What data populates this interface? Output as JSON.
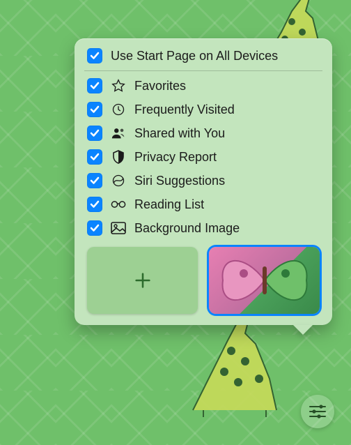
{
  "popover": {
    "master": {
      "label": "Use Start Page on All Devices",
      "checked": true
    },
    "items": [
      {
        "label": "Favorites",
        "icon": "star-icon",
        "checked": true
      },
      {
        "label": "Frequently Visited",
        "icon": "clock-icon",
        "checked": true
      },
      {
        "label": "Shared with You",
        "icon": "people-icon",
        "checked": true
      },
      {
        "label": "Privacy Report",
        "icon": "shield-icon",
        "checked": true
      },
      {
        "label": "Siri Suggestions",
        "icon": "siri-icon",
        "checked": true
      },
      {
        "label": "Reading List",
        "icon": "glasses-icon",
        "checked": true
      },
      {
        "label": "Background Image",
        "icon": "photo-icon",
        "checked": true
      }
    ],
    "thumbnails": {
      "add": "add-background-image",
      "selected": "butterfly-wallpaper"
    }
  },
  "controls": {
    "settings": "start-page-settings"
  },
  "colors": {
    "accent": "#0a84ff",
    "popover_bg": "#c3e5bd",
    "page_bg": "#6fc06a"
  }
}
